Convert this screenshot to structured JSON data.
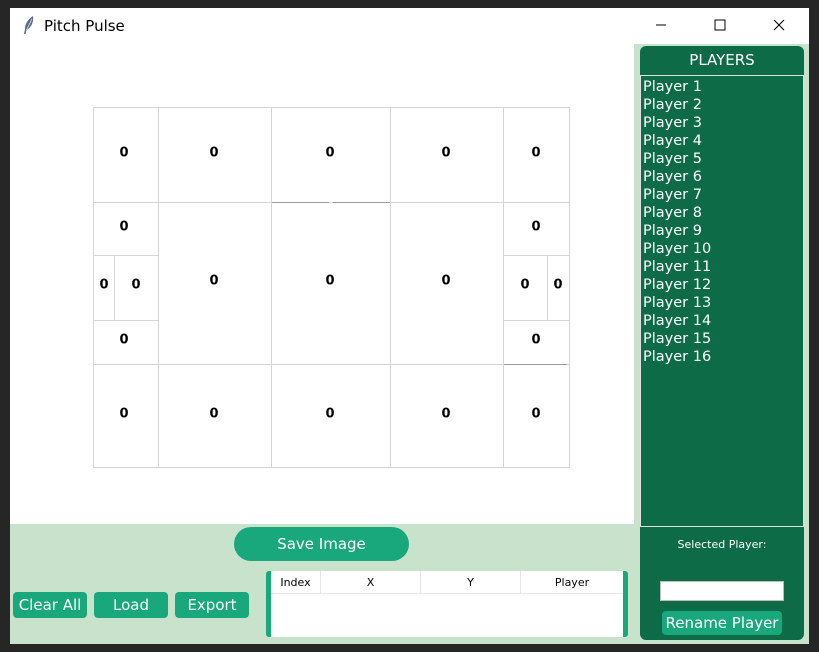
{
  "window": {
    "title": "Pitch Pulse"
  },
  "pitch": {
    "zones": [
      {
        "id": "top-1",
        "value": "0"
      },
      {
        "id": "top-2",
        "value": "0"
      },
      {
        "id": "top-3",
        "value": "0"
      },
      {
        "id": "top-4",
        "value": "0"
      },
      {
        "id": "top-5",
        "value": "0"
      },
      {
        "id": "left-box-top",
        "value": "0"
      },
      {
        "id": "left-goal-outer",
        "value": "0"
      },
      {
        "id": "left-goal-inner",
        "value": "0"
      },
      {
        "id": "left-box-bottom",
        "value": "0"
      },
      {
        "id": "mid-1",
        "value": "0"
      },
      {
        "id": "mid-2",
        "value": "0"
      },
      {
        "id": "mid-3",
        "value": "0"
      },
      {
        "id": "right-box-top",
        "value": "0"
      },
      {
        "id": "right-goal-inner",
        "value": "0"
      },
      {
        "id": "right-goal-outer",
        "value": "0"
      },
      {
        "id": "right-box-bottom",
        "value": "0"
      },
      {
        "id": "bottom-1",
        "value": "0"
      },
      {
        "id": "bottom-2",
        "value": "0"
      },
      {
        "id": "bottom-3",
        "value": "0"
      },
      {
        "id": "bottom-4",
        "value": "0"
      },
      {
        "id": "bottom-5",
        "value": "0"
      }
    ]
  },
  "players": {
    "header": "PLAYERS",
    "items": [
      "Player 1",
      "Player 2",
      "Player 3",
      "Player 4",
      "Player 5",
      "Player 6",
      "Player 7",
      "Player 8",
      "Player 9",
      "Player 10",
      "Player 11",
      "Player 12",
      "Player 13",
      "Player 14",
      "Player 15",
      "Player 16"
    ],
    "selected_label": "Selected Player:",
    "selected_value": "",
    "rename_label": "Rename Player"
  },
  "actions": {
    "save_image": "Save Image",
    "clear_all": "Clear All",
    "load": "Load",
    "export": "Export"
  },
  "table": {
    "columns": [
      "Index",
      "X",
      "Y",
      "Player"
    ]
  },
  "colors": {
    "panel_green": "#0d6b47",
    "button_green": "#19a77c",
    "background_mint": "#c9e2cc"
  }
}
